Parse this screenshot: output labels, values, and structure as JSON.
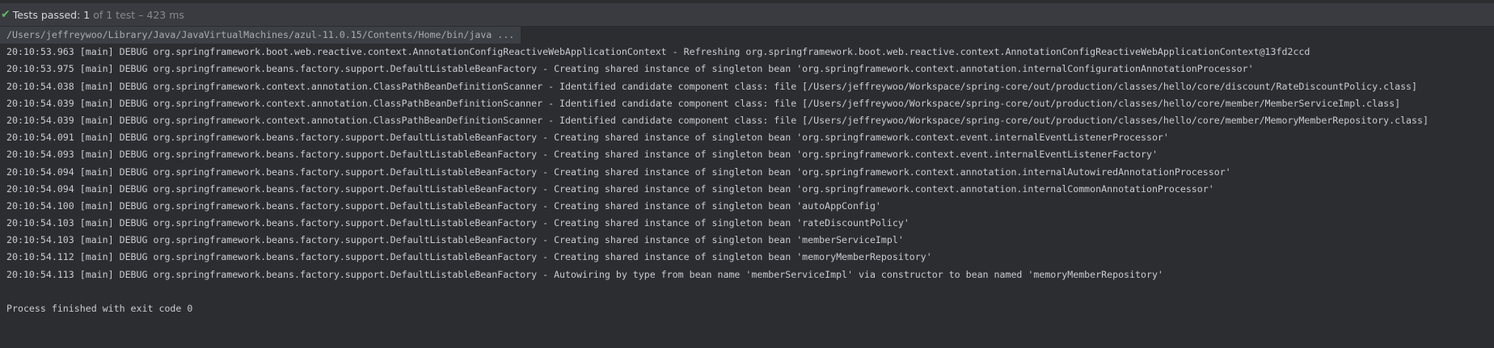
{
  "header": {
    "status_icon": "check-icon",
    "passed_label": "Tests passed: 1",
    "detail": "of 1 test – 423 ms"
  },
  "console": {
    "command": "/Users/jeffreywoo/Library/Java/JavaVirtualMachines/azul-11.0.15/Contents/Home/bin/java ...",
    "lines": [
      "20:10:53.963 [main] DEBUG org.springframework.boot.web.reactive.context.AnnotationConfigReactiveWebApplicationContext - Refreshing org.springframework.boot.web.reactive.context.AnnotationConfigReactiveWebApplicationContext@13fd2ccd",
      "20:10:53.975 [main] DEBUG org.springframework.beans.factory.support.DefaultListableBeanFactory - Creating shared instance of singleton bean 'org.springframework.context.annotation.internalConfigurationAnnotationProcessor'",
      "20:10:54.038 [main] DEBUG org.springframework.context.annotation.ClassPathBeanDefinitionScanner - Identified candidate component class: file [/Users/jeffreywoo/Workspace/spring-core/out/production/classes/hello/core/discount/RateDiscountPolicy.class]",
      "20:10:54.039 [main] DEBUG org.springframework.context.annotation.ClassPathBeanDefinitionScanner - Identified candidate component class: file [/Users/jeffreywoo/Workspace/spring-core/out/production/classes/hello/core/member/MemberServiceImpl.class]",
      "20:10:54.039 [main] DEBUG org.springframework.context.annotation.ClassPathBeanDefinitionScanner - Identified candidate component class: file [/Users/jeffreywoo/Workspace/spring-core/out/production/classes/hello/core/member/MemoryMemberRepository.class]",
      "20:10:54.091 [main] DEBUG org.springframework.beans.factory.support.DefaultListableBeanFactory - Creating shared instance of singleton bean 'org.springframework.context.event.internalEventListenerProcessor'",
      "20:10:54.093 [main] DEBUG org.springframework.beans.factory.support.DefaultListableBeanFactory - Creating shared instance of singleton bean 'org.springframework.context.event.internalEventListenerFactory'",
      "20:10:54.094 [main] DEBUG org.springframework.beans.factory.support.DefaultListableBeanFactory - Creating shared instance of singleton bean 'org.springframework.context.annotation.internalAutowiredAnnotationProcessor'",
      "20:10:54.094 [main] DEBUG org.springframework.beans.factory.support.DefaultListableBeanFactory - Creating shared instance of singleton bean 'org.springframework.context.annotation.internalCommonAnnotationProcessor'",
      "20:10:54.100 [main] DEBUG org.springframework.beans.factory.support.DefaultListableBeanFactory - Creating shared instance of singleton bean 'autoAppConfig'",
      "20:10:54.103 [main] DEBUG org.springframework.beans.factory.support.DefaultListableBeanFactory - Creating shared instance of singleton bean 'rateDiscountPolicy'",
      "20:10:54.103 [main] DEBUG org.springframework.beans.factory.support.DefaultListableBeanFactory - Creating shared instance of singleton bean 'memberServiceImpl'",
      "20:10:54.112 [main] DEBUG org.springframework.beans.factory.support.DefaultListableBeanFactory - Creating shared instance of singleton bean 'memoryMemberRepository'",
      "20:10:54.113 [main] DEBUG org.springframework.beans.factory.support.DefaultListableBeanFactory - Autowiring by type from bean name 'memberServiceImpl' via constructor to bean named 'memoryMemberRepository'"
    ],
    "exit_message": "Process finished with exit code 0"
  }
}
